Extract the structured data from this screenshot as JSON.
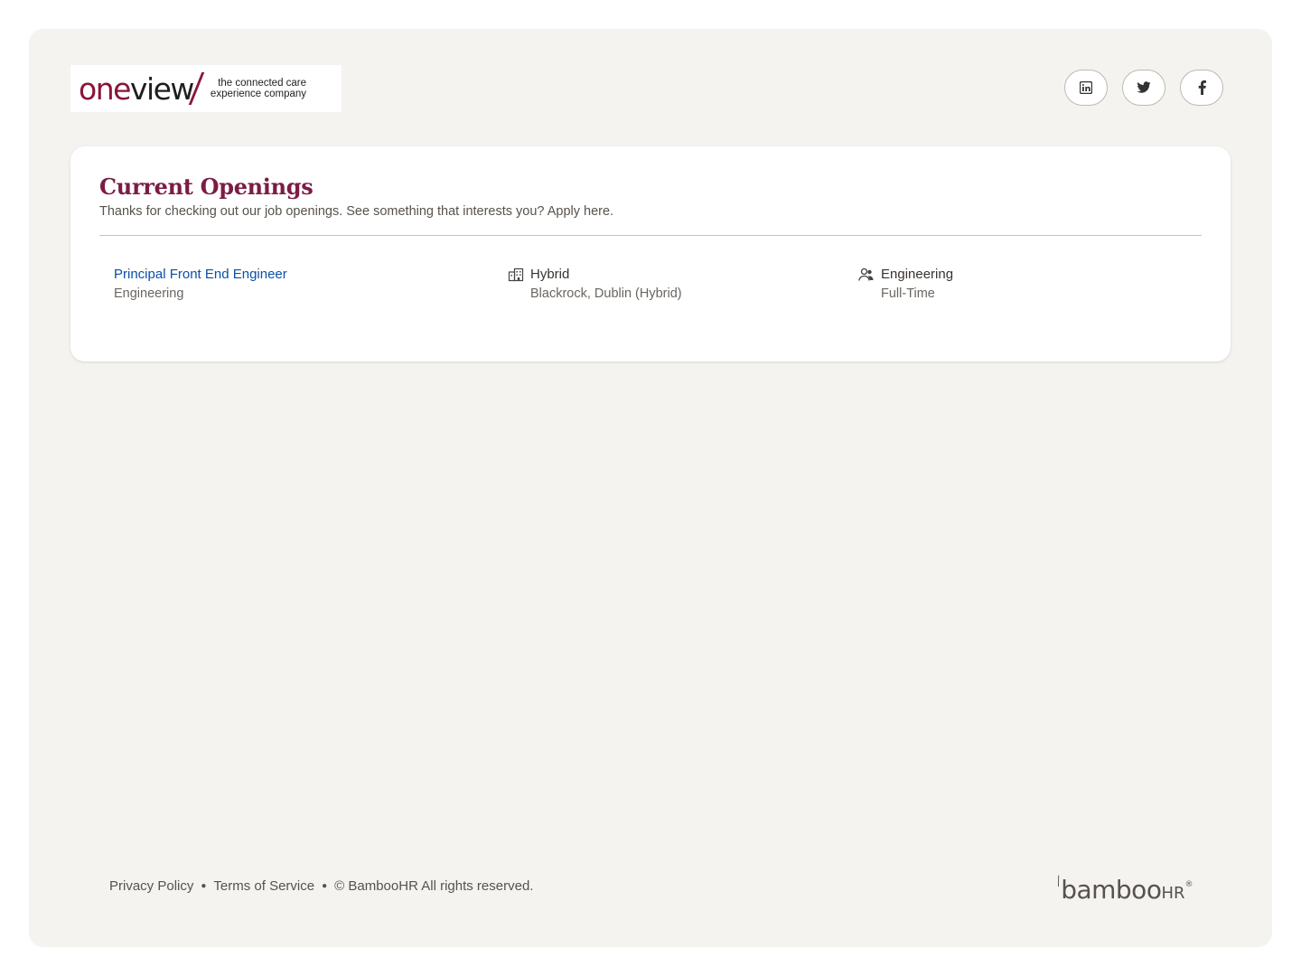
{
  "header": {
    "logo": {
      "word_part1": "one",
      "word_part2": "view",
      "tagline_line1": "the connected care",
      "tagline_line2": "experience company"
    },
    "social": [
      {
        "icon": "linkedin-icon"
      },
      {
        "icon": "twitter-icon"
      },
      {
        "icon": "facebook-icon"
      }
    ]
  },
  "openings": {
    "title": "Current Openings",
    "subtitle": "Thanks for checking out our job openings. See something that interests you? Apply here.",
    "jobs": [
      {
        "title": "Principal Front End Engineer",
        "department_under_title": "Engineering",
        "location_type": "Hybrid",
        "location": "Blackrock, Dublin (Hybrid)",
        "department": "Engineering",
        "employment_type": "Full-Time"
      }
    ]
  },
  "footer": {
    "privacy": "Privacy Policy",
    "terms": "Terms of Service",
    "copyright": "© BambooHR All rights reserved.",
    "brand_main": "bamboo",
    "brand_suffix": "HR",
    "brand_mark": "®"
  },
  "colors": {
    "brand": "#8a1538",
    "title": "#7b1c45",
    "link": "#0b4fa8",
    "page_bg": "#f5f3f0"
  }
}
